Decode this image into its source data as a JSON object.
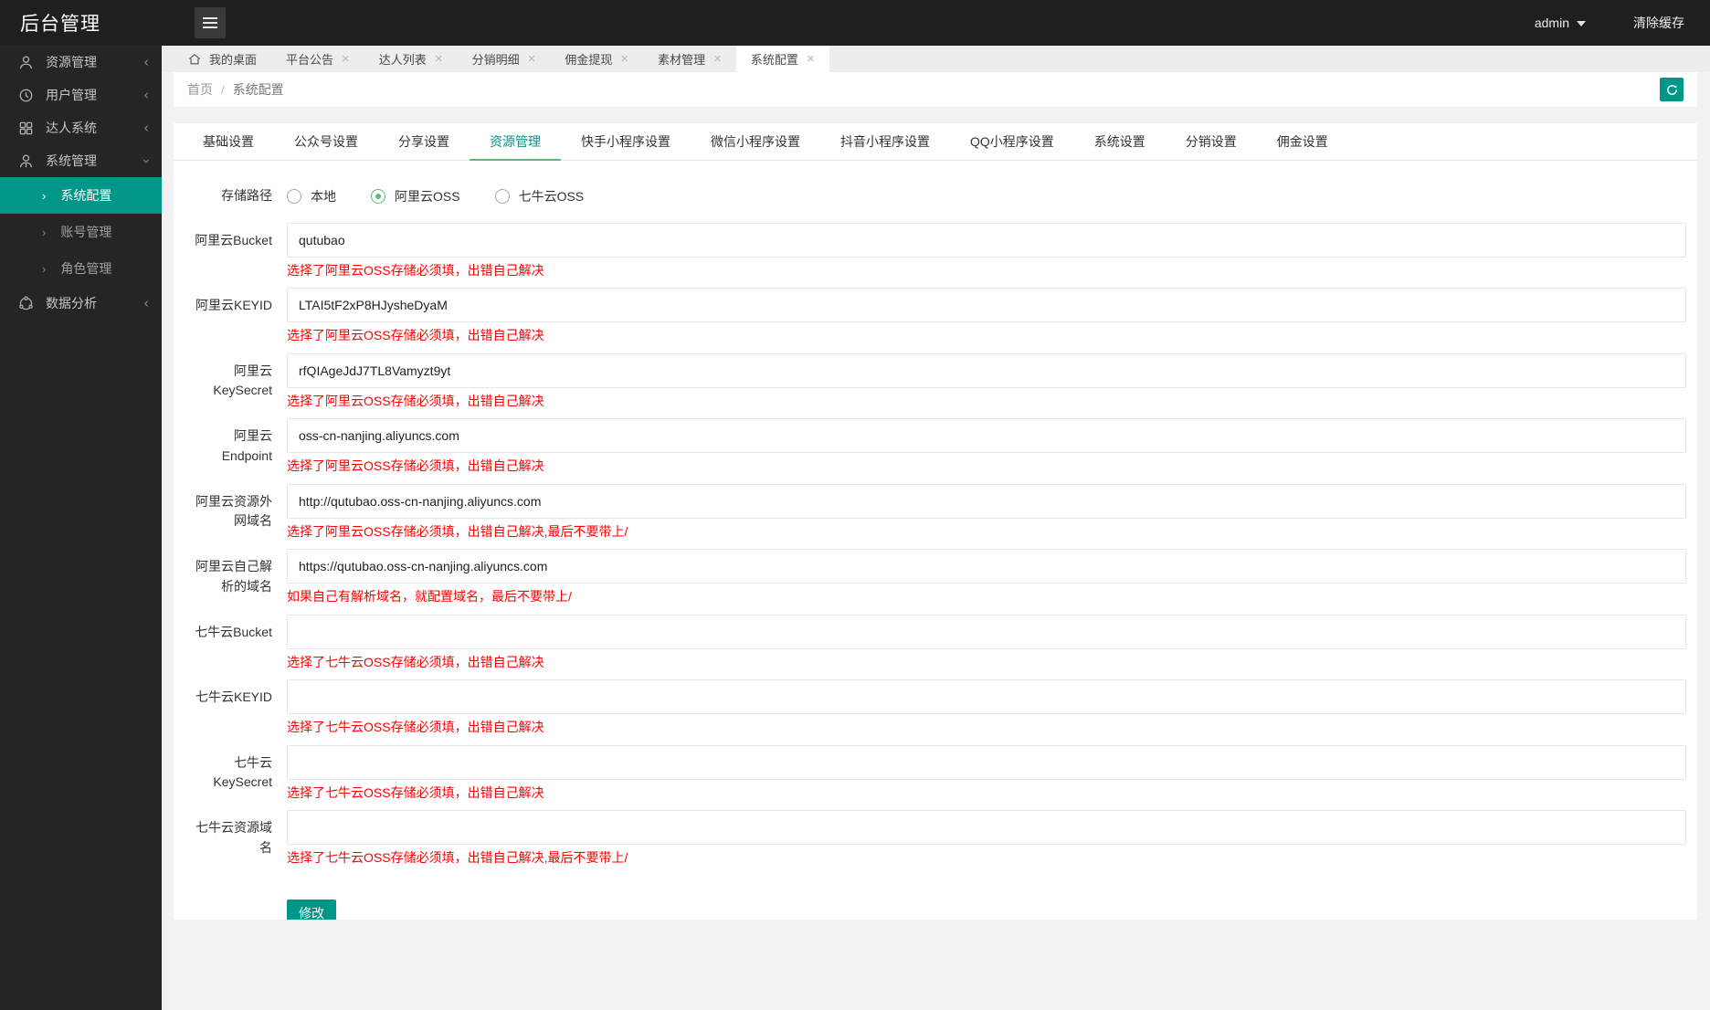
{
  "header": {
    "title": "后台管理",
    "user": "admin",
    "clear_cache_label": "清除缓存"
  },
  "sidebar": {
    "items": [
      {
        "label": "资源管理",
        "icon": "user-icon",
        "state": "collapsed"
      },
      {
        "label": "用户管理",
        "icon": "clock-icon",
        "state": "collapsed"
      },
      {
        "label": "达人系统",
        "icon": "grid-icon",
        "state": "collapsed"
      },
      {
        "label": "系统管理",
        "icon": "user-gear-icon",
        "state": "expanded"
      },
      {
        "label": "数据分析",
        "icon": "share-network-icon",
        "state": "collapsed"
      }
    ],
    "subitems": [
      {
        "label": "系统配置",
        "active": true
      },
      {
        "label": "账号管理",
        "active": false
      },
      {
        "label": "角色管理",
        "active": false
      }
    ]
  },
  "tabbar": {
    "tabs": [
      {
        "label": "我的桌面",
        "closable": false,
        "active": false
      },
      {
        "label": "平台公告",
        "closable": true,
        "active": false
      },
      {
        "label": "达人列表",
        "closable": true,
        "active": false
      },
      {
        "label": "分销明细",
        "closable": true,
        "active": false
      },
      {
        "label": "佣金提现",
        "closable": true,
        "active": false
      },
      {
        "label": "素材管理",
        "closable": true,
        "active": false
      },
      {
        "label": "系统配置",
        "closable": true,
        "active": true
      }
    ]
  },
  "breadcrumb": {
    "home": "首页",
    "separator": "/",
    "current": "系统配置"
  },
  "settings_tabs": {
    "active_index": 3,
    "labels": [
      "基础设置",
      "公众号设置",
      "分享设置",
      "资源管理",
      "快手小程序设置",
      "微信小程序设置",
      "抖音小程序设置",
      "QQ小程序设置",
      "系统设置",
      "分销设置",
      "佣金设置"
    ]
  },
  "form": {
    "storage_label": "存储路径",
    "storage_options": [
      {
        "label": "本地",
        "checked": false
      },
      {
        "label": "阿里云OSS",
        "checked": true
      },
      {
        "label": "七牛云OSS",
        "checked": false
      }
    ],
    "fields": [
      {
        "label": "阿里云Bucket",
        "value": "qutubao",
        "hint": "选择了阿里云OSS存储必须填，出错自己解决"
      },
      {
        "label": "阿里云KEYID",
        "value": "LTAI5tF2xP8HJysheDyaM",
        "hint": "选择了阿里云OSS存储必须填，出错自己解决"
      },
      {
        "label": "阿里云KeySecret",
        "value": "rfQIAgeJdJ7TL8Vamyzt9yt",
        "hint": "选择了阿里云OSS存储必须填，出错自己解决"
      },
      {
        "label": "阿里云Endpoint",
        "value": "oss-cn-nanjing.aliyuncs.com",
        "hint": "选择了阿里云OSS存储必须填，出错自己解决"
      },
      {
        "label": "阿里云资源外网域名",
        "value": "http://qutubao.oss-cn-nanjing.aliyuncs.com",
        "hint": "选择了阿里云OSS存储必须填，出错自己解决,最后不要带上/"
      },
      {
        "label": "阿里云自己解析的域名",
        "value": "https://qutubao.oss-cn-nanjing.aliyuncs.com",
        "hint": "如果自己有解析域名，就配置域名，最后不要带上/"
      },
      {
        "label": "七牛云Bucket",
        "value": "",
        "hint": "选择了七牛云OSS存储必须填，出错自己解决"
      },
      {
        "label": "七牛云KEYID",
        "value": "",
        "hint": "选择了七牛云OSS存储必须填，出错自己解决"
      },
      {
        "label": "七牛云KeySecret",
        "value": "",
        "hint": "选择了七牛云OSS存储必须填，出错自己解决"
      },
      {
        "label": "七牛云资源域名",
        "value": "",
        "hint": "选择了七牛云OSS存储必须填，出错自己解决,最后不要带上/"
      }
    ],
    "submit_label": "修改"
  },
  "colors": {
    "accent": "#009688",
    "tab_underline": "#5FB878",
    "radio_checked": "#5FB878",
    "hint_text": "#ff0000",
    "header_bg": "#1f1f1f",
    "sidebar_bg": "#252525"
  }
}
